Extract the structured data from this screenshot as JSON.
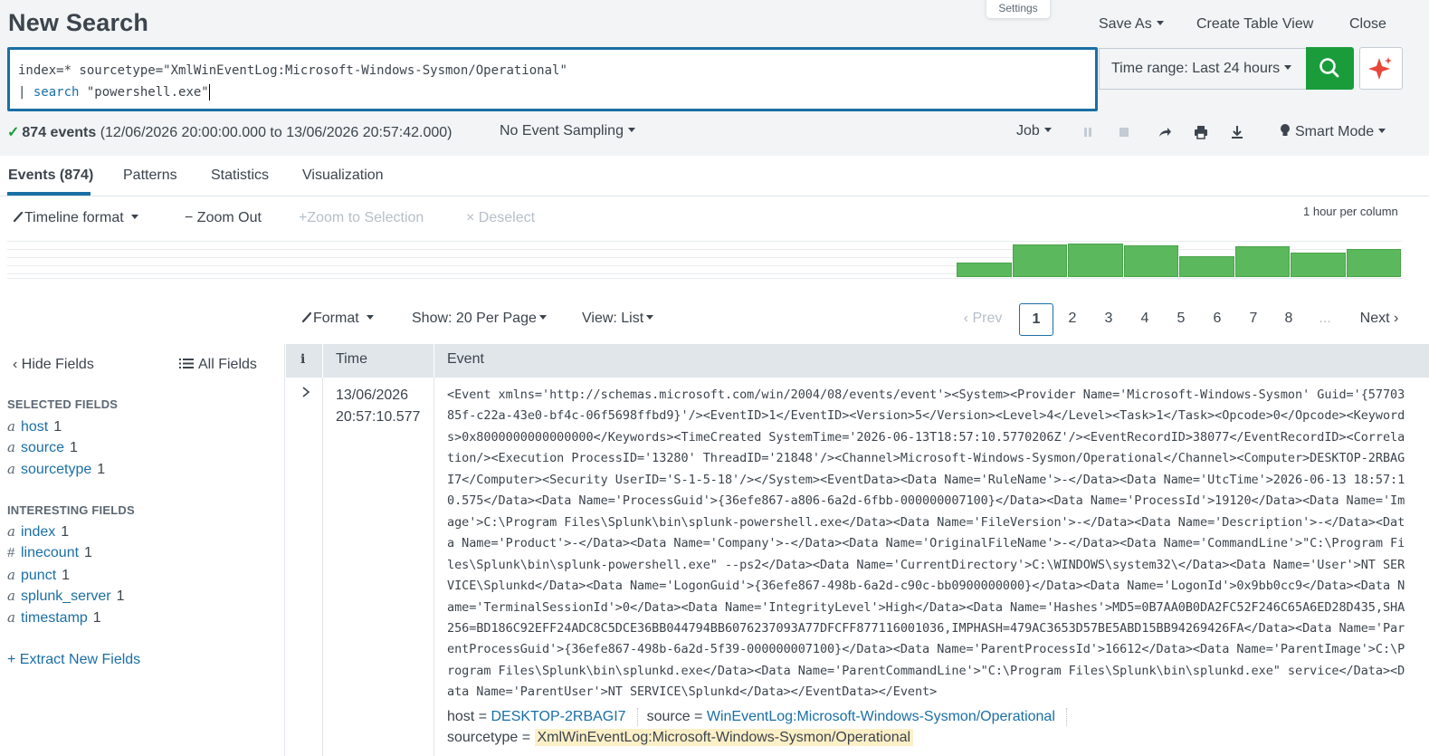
{
  "header": {
    "title": "New Search",
    "settings_tooltip": "Settings",
    "save_as": "Save As",
    "create_table_view": "Create Table View",
    "close": "Close"
  },
  "search": {
    "line1": "index=* sourcetype=\"XmlWinEventLog:Microsoft-Windows-Sysmon/Operational\"",
    "line2_pipe": "| ",
    "line2_cmd": "search",
    "line2_arg": " \"powershell.exe\"",
    "time_range": "Time range: Last 24 hours",
    "accent_color": "#1a9c3b"
  },
  "status": {
    "count": "874 events",
    "range": " (12/06/2026 20:00:00.000 to 13/06/2026 20:57:42.000)",
    "sampling": "No Event Sampling",
    "job": "Job",
    "mode": "Smart Mode"
  },
  "tabs": [
    {
      "label": "Events (874)",
      "active": true
    },
    {
      "label": "Patterns"
    },
    {
      "label": "Statistics"
    },
    {
      "label": "Visualization"
    }
  ],
  "timeline": {
    "format": "Timeline format",
    "zoom_out": "Zoom Out",
    "zoom_selection": "Zoom to Selection",
    "deselect": "Deselect",
    "per_column": "1 hour per column",
    "bars": [
      0.45,
      1.0,
      1.03,
      0.98,
      0.65,
      0.94,
      0.74,
      0.85
    ]
  },
  "results_toolbar": {
    "format": "Format",
    "per_page": "Show: 20 Per Page",
    "view": "View: List",
    "prev": "Prev",
    "pages": [
      "1",
      "2",
      "3",
      "4",
      "5",
      "6",
      "7",
      "8",
      "..."
    ],
    "next": "Next"
  },
  "fields": {
    "hide": "Hide Fields",
    "all": "All Fields",
    "selected_title": "SELECTED FIELDS",
    "selected": [
      {
        "type": "a",
        "name": "host",
        "count": "1"
      },
      {
        "type": "a",
        "name": "source",
        "count": "1"
      },
      {
        "type": "a",
        "name": "sourcetype",
        "count": "1"
      }
    ],
    "interesting_title": "INTERESTING FIELDS",
    "interesting": [
      {
        "type": "a",
        "name": "index",
        "count": "1"
      },
      {
        "type": "#",
        "name": "linecount",
        "count": "1"
      },
      {
        "type": "a",
        "name": "punct",
        "count": "1"
      },
      {
        "type": "a",
        "name": "splunk_server",
        "count": "1"
      },
      {
        "type": "a",
        "name": "timestamp",
        "count": "1"
      }
    ],
    "extract": "Extract New Fields"
  },
  "table": {
    "col_i": "i",
    "col_time": "Time",
    "col_event": "Event",
    "row": {
      "date": "13/06/2026",
      "time": "20:57:10.577",
      "raw": "<Event xmlns='http://schemas.microsoft.com/win/2004/08/events/event'><System><Provider Name='Microsoft-Windows-Sysmon' Guid='{5770385f-c22a-43e0-bf4c-06f5698ffbd9}'/><EventID>1</EventID><Version>5</Version><Level>4</Level><Task>1</Task><Opcode>0</Opcode><Keywords>0x8000000000000000</Keywords><TimeCreated SystemTime='2026-06-13T18:57:10.5770206Z'/><EventRecordID>38077</EventRecordID><Correlation/><Execution ProcessID='13280' ThreadID='21848'/><Channel>Microsoft-Windows-Sysmon/Operational</Channel><Computer>DESKTOP-2RBAGI7</Computer><Security UserID='S-1-5-18'/></System><EventData><Data Name='RuleName'>-</Data><Data Name='UtcTime'>2026-06-13 18:57:10.575</Data><Data Name='ProcessGuid'>{36efe867-a806-6a2d-6fbb-000000007100}</Data><Data Name='ProcessId'>19120</Data><Data Name='Image'>C:\\Program Files\\Splunk\\bin\\splunk-powershell.exe</Data><Data Name='FileVersion'>-</Data><Data Name='Description'>-</Data><Data Name='Product'>-</Data><Data Name='Company'>-</Data><Data Name='OriginalFileName'>-</Data><Data Name='CommandLine'>\"C:\\Program Files\\Splunk\\bin\\splunk-powershell.exe\" --ps2</Data><Data Name='CurrentDirectory'>C:\\WINDOWS\\system32\\</Data><Data Name='User'>NT SERVICE\\Splunkd</Data><Data Name='LogonGuid'>{36efe867-498b-6a2d-c90c-bb0900000000}</Data><Data Name='LogonId'>0x9bb0cc9</Data><Data Name='TerminalSessionId'>0</Data><Data Name='IntegrityLevel'>High</Data><Data Name='Hashes'>MD5=0B7AA0B0DA2FC52F246C65A6ED28D435,SHA256=BD186C92EFF24ADC8C5DCE36BB044794BB6076237093A77DFCFF877116001036,IMPHASH=479AC3653D57BE5ABD15BB94269426FA</Data><Data Name='ParentProcessGuid'>{36efe867-498b-6a2d-5f39-000000007100}</Data><Data Name='ParentProcessId'>16612</Data><Data Name='ParentImage'>C:\\Program Files\\Splunk\\bin\\splunkd.exe</Data><Data Name='ParentCommandLine'>\"C:\\Program Files\\Splunk\\bin\\splunkd.exe\" service</Data><Data Name='ParentUser'>NT SERVICE\\Splunkd</Data></EventData></Event>",
      "host_label": "host = ",
      "host": "DESKTOP-2RBAGI7",
      "source_label": "source = ",
      "source": "WinEventLog:Microsoft-Windows-Sysmon/Operational",
      "sourcetype_label": "sourcetype = ",
      "sourcetype": "XmlWinEventLog:Microsoft-Windows-Sysmon/Operational"
    }
  }
}
